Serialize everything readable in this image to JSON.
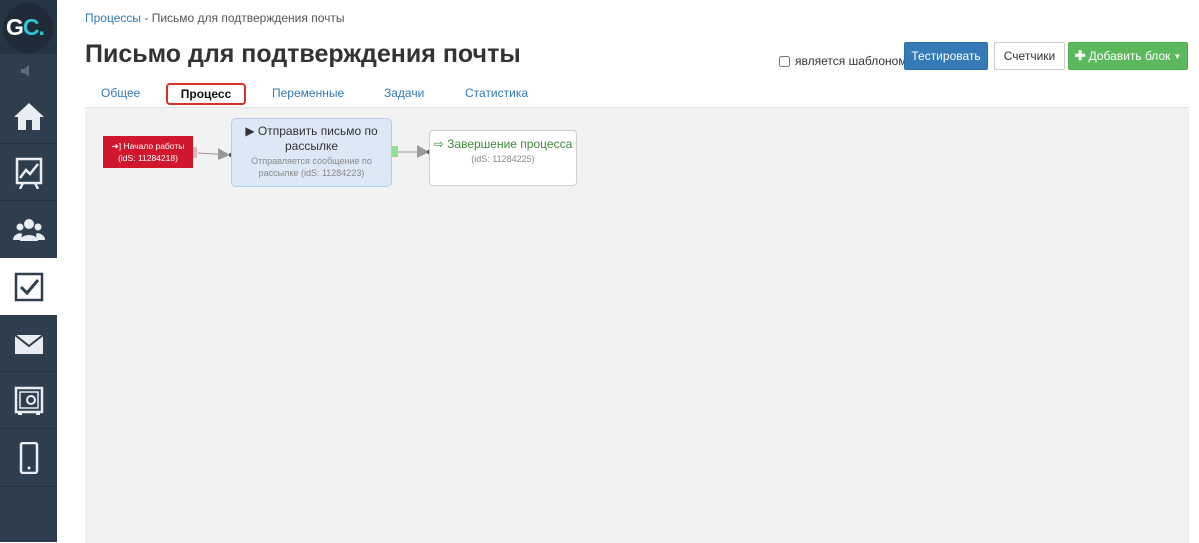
{
  "logo": {
    "g": "G",
    "c": "C",
    "dot": "."
  },
  "sidebar": {
    "items": [
      {
        "icon": "home-icon",
        "active": false
      },
      {
        "icon": "chart-board-icon",
        "active": false
      },
      {
        "icon": "users-icon",
        "active": false
      },
      {
        "icon": "checkbox-icon",
        "active": true
      },
      {
        "icon": "envelope-icon",
        "active": false
      },
      {
        "icon": "safe-icon",
        "active": false
      },
      {
        "icon": "mobile-icon",
        "active": false
      }
    ]
  },
  "breadcrumb": {
    "parent": "Процессы",
    "separator": " - ",
    "current": "Письмо для подтверждения почты"
  },
  "page": {
    "title": "Письмо для подтверждения почты"
  },
  "toolbar": {
    "template_label": "является шаблоном",
    "template_checked": false,
    "test_label": "Тестировать",
    "counters_label": "Счетчики",
    "add_block_label": "Добавить блок"
  },
  "tabs": [
    {
      "label": "Общее",
      "active": false
    },
    {
      "label": "Процесс",
      "active": true
    },
    {
      "label": "Переменные",
      "active": false
    },
    {
      "label": "Задачи",
      "active": false
    },
    {
      "label": "Статистика",
      "active": false
    }
  ],
  "process": {
    "start": {
      "title": "Начало работы",
      "id": "(idS: 11284218)",
      "icon": "sign-in-icon"
    },
    "send": {
      "title": "Отправить письмо по рассылке",
      "subtitle": "Отправляется сообщение по рассылке (idS: 11284223)",
      "icon": "play-icon"
    },
    "end": {
      "title": "Завершение процесса",
      "id": "(idS: 11284225)",
      "icon": "sign-out-icon"
    }
  },
  "colors": {
    "sidebar": "#2e3e4e",
    "primary": "#337ab7",
    "success": "#5cb85c",
    "start": "#d0172d",
    "active_tab_border": "#d9302a"
  }
}
